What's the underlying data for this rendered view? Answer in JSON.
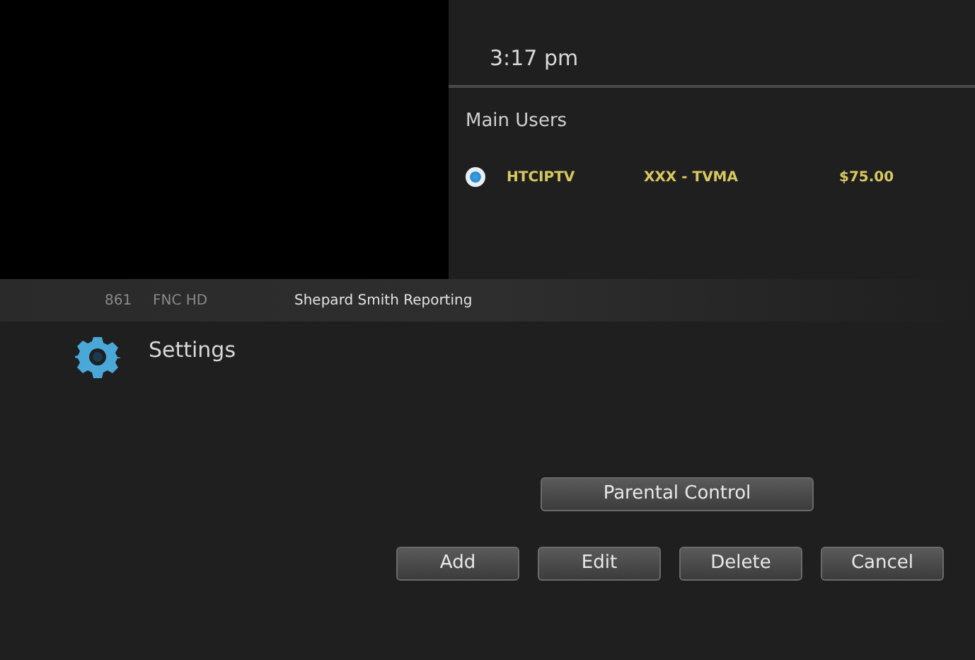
{
  "clock": "3:17 pm",
  "users_panel": {
    "title": "Main Users",
    "rows": [
      {
        "selected": true,
        "name": "HTCIPTV",
        "rating": "XXX - TVMA",
        "price": "$75.00"
      }
    ]
  },
  "now_playing": {
    "channel": "861",
    "network": "FNC HD",
    "program": "Shepard Smith Reporting"
  },
  "section": {
    "title": "Settings"
  },
  "buttons": [
    {
      "label": "Parental Control",
      "kind": "wide"
    },
    {
      "label": "Add",
      "kind": "action"
    },
    {
      "label": "Edit",
      "kind": "action"
    },
    {
      "label": "Delete",
      "kind": "action"
    },
    {
      "label": "Cancel",
      "kind": "action"
    }
  ]
}
